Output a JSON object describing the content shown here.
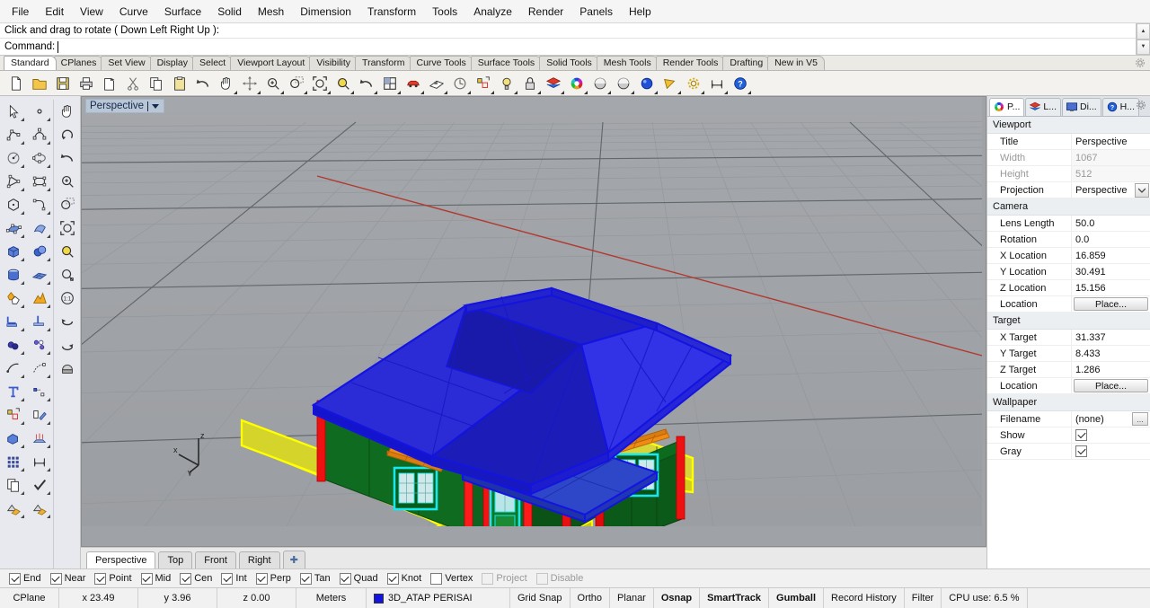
{
  "menu": {
    "items": [
      "File",
      "Edit",
      "View",
      "Curve",
      "Surface",
      "Solid",
      "Mesh",
      "Dimension",
      "Transform",
      "Tools",
      "Analyze",
      "Render",
      "Panels",
      "Help"
    ]
  },
  "command": {
    "history": "Click and drag to rotate ( Down  Left  Right  Up ):",
    "prompt_label": "Command:",
    "value": "",
    "scroll_up_icon": "scroll-up-icon",
    "scroll_down_icon": "scroll-down-icon"
  },
  "toolbar_tabs": {
    "items": [
      "Standard",
      "CPlanes",
      "Set View",
      "Display",
      "Select",
      "Viewport Layout",
      "Visibility",
      "Transform",
      "Curve Tools",
      "Surface Tools",
      "Solid Tools",
      "Mesh Tools",
      "Render Tools",
      "Drafting",
      "New in V5"
    ],
    "active": "Standard",
    "options_icon": "gear-icon"
  },
  "main_toolbar": {
    "buttons": [
      {
        "name": "new-file-icon",
        "tip": "New"
      },
      {
        "name": "open-file-icon",
        "tip": "Open"
      },
      {
        "name": "save-file-icon",
        "tip": "Save"
      },
      {
        "name": "print-icon",
        "tip": "Print"
      },
      {
        "name": "export-icon",
        "tip": "Export"
      },
      {
        "name": "cut-icon",
        "tip": "Cut"
      },
      {
        "name": "copy-icon",
        "tip": "Copy"
      },
      {
        "name": "paste-icon",
        "tip": "Paste"
      },
      {
        "name": "undo-icon",
        "tip": "Undo"
      },
      {
        "name": "pan-hand-icon",
        "tip": "Pan"
      },
      {
        "name": "gumball-move-icon",
        "tip": "Move"
      },
      {
        "name": "zoom-in-icon",
        "tip": "Zoom In"
      },
      {
        "name": "zoom-window-icon",
        "tip": "Zoom Window"
      },
      {
        "name": "zoom-extents-icon",
        "tip": "Zoom Extents"
      },
      {
        "name": "zoom-selected-icon",
        "tip": "Zoom Selected"
      },
      {
        "name": "undo-view-icon",
        "tip": "Undo View Change"
      },
      {
        "name": "viewport-layout-icon",
        "tip": "4 Viewports"
      },
      {
        "name": "car-render-icon",
        "tip": "Render"
      },
      {
        "name": "layout-page-icon",
        "tip": "Layout"
      },
      {
        "name": "clock-icon",
        "tip": "History"
      },
      {
        "name": "named-selection-icon",
        "tip": "Named Selection"
      },
      {
        "name": "light-bulb-icon",
        "tip": "Lights"
      },
      {
        "name": "lock-icon",
        "tip": "Lock"
      },
      {
        "name": "layers-icon",
        "tip": "Layers"
      },
      {
        "name": "color-wheel-icon",
        "tip": "Color"
      },
      {
        "name": "shaded-sphere-icon",
        "tip": "Shaded"
      },
      {
        "name": "ghosted-sphere-icon",
        "tip": "Ghosted"
      },
      {
        "name": "rendered-sphere-icon",
        "tip": "Rendered"
      },
      {
        "name": "flat-shade-icon",
        "tip": "Flat Shade"
      },
      {
        "name": "options-gear-icon",
        "tip": "Options"
      },
      {
        "name": "dimension-icon",
        "tip": "Dimension"
      },
      {
        "name": "help-icon",
        "tip": "Help"
      }
    ]
  },
  "left_rail": {
    "col1": [
      {
        "name": "select-arrow-icon"
      },
      {
        "name": "polyline-icon"
      },
      {
        "name": "circle-icon"
      },
      {
        "name": "polygon-triangle-icon"
      },
      {
        "name": "hexagon-icon"
      },
      {
        "name": "surface-edit-points-icon"
      },
      {
        "name": "box-solid-icon"
      },
      {
        "name": "cylinder-solid-icon"
      },
      {
        "name": "boolean-union-icon"
      },
      {
        "name": "fillet-edge-icon"
      },
      {
        "name": "blend-surface-icon"
      },
      {
        "name": "curve-from-object-icon"
      },
      {
        "name": "text-object-icon"
      },
      {
        "name": "group-icon"
      },
      {
        "name": "extrude-solid-icon"
      },
      {
        "name": "array-icon"
      },
      {
        "name": "copy-object-icon"
      },
      {
        "name": "mesh-from-surface-icon"
      }
    ],
    "col2": [
      {
        "name": "point-object-icon"
      },
      {
        "name": "control-point-curve-icon"
      },
      {
        "name": "ellipse-icon"
      },
      {
        "name": "rectangle-icon"
      },
      {
        "name": "curve-arc-icon"
      },
      {
        "name": "surface-sweep-icon"
      },
      {
        "name": "sphere-solid-icon"
      },
      {
        "name": "surface-grid-icon"
      },
      {
        "name": "explode-icon"
      },
      {
        "name": "trim-split-icon"
      },
      {
        "name": "offset-curve-icon"
      },
      {
        "name": "rebuild-curve-icon"
      },
      {
        "name": "point-edit-icon"
      },
      {
        "name": "rotate-object-icon"
      },
      {
        "name": "loft-icon"
      },
      {
        "name": "dimension-linear-icon"
      },
      {
        "name": "check-object-icon"
      },
      {
        "name": "render-material-icon"
      }
    ],
    "col3": [
      {
        "name": "pan-hand-icon"
      },
      {
        "name": "rotate-view-icon"
      },
      {
        "name": "undo-view-icon"
      },
      {
        "name": "zoom-in-icon"
      },
      {
        "name": "zoom-window-icon"
      },
      {
        "name": "zoom-extents-icon"
      },
      {
        "name": "zoom-selected-icon"
      },
      {
        "name": "zoom-target-icon"
      },
      {
        "name": "zoom-1to1-icon"
      },
      {
        "name": "view-rotate-back-icon"
      },
      {
        "name": "view-rotate-left-icon"
      },
      {
        "name": "named-view-icon"
      }
    ]
  },
  "viewport": {
    "label": "Perspective",
    "dropdown_icon": "chevron-down-icon",
    "axis": {
      "x": "x",
      "y": "y",
      "z": "z"
    },
    "tabs": [
      {
        "label": "Perspective",
        "active": true
      },
      {
        "label": "Top",
        "active": false
      },
      {
        "label": "Front",
        "active": false
      },
      {
        "label": "Right",
        "active": false
      }
    ],
    "add_tab_icon": "add-viewport-icon",
    "colors": {
      "background": "#9fa2a6",
      "grid_minor": "#999ca0",
      "grid_major": "#6a6d71",
      "axis_x_red": "#b03a30",
      "roof_blue": "#1414e0",
      "wall_green": "#0d6b1d",
      "column_red": "#ee1111",
      "window_cyan": "#16e8ee",
      "awning_orange": "#f08c14",
      "floor_yellow": "#ffff00"
    }
  },
  "properties_panel": {
    "tabs": [
      {
        "label": "P...",
        "icon": "color-wheel-icon",
        "active": true
      },
      {
        "label": "L...",
        "icon": "layers-icon",
        "active": false
      },
      {
        "label": "Di...",
        "icon": "display-monitor-icon",
        "active": false
      },
      {
        "label": "H...",
        "icon": "help-panel-icon",
        "active": false
      }
    ],
    "options_icon": "gear-icon",
    "groups": [
      {
        "title": "Viewport",
        "rows": [
          {
            "key": "Title",
            "value": "Perspective",
            "type": "text",
            "disabled": false
          },
          {
            "key": "Width",
            "value": "1067",
            "type": "text",
            "disabled": true
          },
          {
            "key": "Height",
            "value": "512",
            "type": "text",
            "disabled": true
          },
          {
            "key": "Projection",
            "value": "Perspective",
            "type": "dropdown",
            "disabled": false
          }
        ]
      },
      {
        "title": "Camera",
        "rows": [
          {
            "key": "Lens Length",
            "value": "50.0",
            "type": "text",
            "disabled": false
          },
          {
            "key": "Rotation",
            "value": "0.0",
            "type": "text",
            "disabled": false
          },
          {
            "key": "X Location",
            "value": "16.859",
            "type": "text",
            "disabled": false
          },
          {
            "key": "Y Location",
            "value": "30.491",
            "type": "text",
            "disabled": false
          },
          {
            "key": "Z Location",
            "value": "15.156",
            "type": "text",
            "disabled": false
          },
          {
            "key": "Location",
            "value": "Place...",
            "type": "button",
            "disabled": false
          }
        ]
      },
      {
        "title": "Target",
        "rows": [
          {
            "key": "X Target",
            "value": "31.337",
            "type": "text",
            "disabled": false
          },
          {
            "key": "Y Target",
            "value": "8.433",
            "type": "text",
            "disabled": false
          },
          {
            "key": "Z Target",
            "value": "1.286",
            "type": "text",
            "disabled": false
          },
          {
            "key": "Location",
            "value": "Place...",
            "type": "button",
            "disabled": false
          }
        ]
      },
      {
        "title": "Wallpaper",
        "rows": [
          {
            "key": "Filename",
            "value": "(none)",
            "type": "file",
            "disabled": false,
            "browse_label": "..."
          },
          {
            "key": "Show",
            "value": "",
            "type": "checkbox",
            "checked": true
          },
          {
            "key": "Gray",
            "value": "",
            "type": "checkbox",
            "checked": true
          }
        ]
      }
    ]
  },
  "osnap": {
    "items": [
      {
        "label": "End",
        "checked": true,
        "enabled": true
      },
      {
        "label": "Near",
        "checked": true,
        "enabled": true
      },
      {
        "label": "Point",
        "checked": true,
        "enabled": true
      },
      {
        "label": "Mid",
        "checked": true,
        "enabled": true
      },
      {
        "label": "Cen",
        "checked": true,
        "enabled": true
      },
      {
        "label": "Int",
        "checked": true,
        "enabled": true
      },
      {
        "label": "Perp",
        "checked": true,
        "enabled": true
      },
      {
        "label": "Tan",
        "checked": true,
        "enabled": true
      },
      {
        "label": "Quad",
        "checked": true,
        "enabled": true
      },
      {
        "label": "Knot",
        "checked": true,
        "enabled": true
      },
      {
        "label": "Vertex",
        "checked": false,
        "enabled": true
      },
      {
        "label": "Project",
        "checked": false,
        "enabled": false
      },
      {
        "label": "Disable",
        "checked": false,
        "enabled": false
      }
    ]
  },
  "statusbar": {
    "cplane": "CPlane",
    "x": "x 23.49",
    "y": "y 3.96",
    "z": "z 0.00",
    "units": "Meters",
    "layer": {
      "name": "3D_ATAP PERISAI",
      "color": "#1414e0"
    },
    "toggles": [
      {
        "label": "Grid Snap",
        "on": false
      },
      {
        "label": "Ortho",
        "on": false
      },
      {
        "label": "Planar",
        "on": false
      },
      {
        "label": "Osnap",
        "on": true
      },
      {
        "label": "SmartTrack",
        "on": true
      },
      {
        "label": "Gumball",
        "on": true
      },
      {
        "label": "Record History",
        "on": false
      },
      {
        "label": "Filter",
        "on": false
      }
    ],
    "cpu": "CPU use: 6.5 %"
  }
}
